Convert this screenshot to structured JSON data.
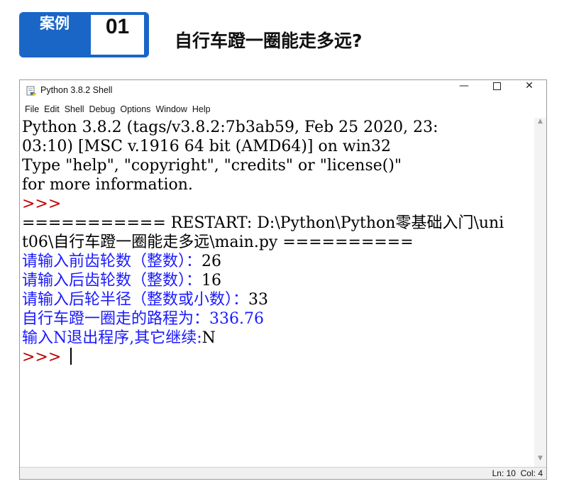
{
  "case": {
    "label": "案例",
    "number": "01",
    "title": "自行车蹬一圈能走多远?"
  },
  "window": {
    "title": "Python 3.8.2 Shell",
    "minimize_glyph": "—",
    "close_glyph": "✕",
    "icon": "idle-python-icon"
  },
  "menu": [
    "File",
    "Edit",
    "Shell",
    "Debug",
    "Options",
    "Window",
    "Help"
  ],
  "shell": {
    "lines": [
      {
        "text": "Python 3.8.2 (tags/v3.8.2:7b3ab59, Feb 25 2020, 23:",
        "type": "system"
      },
      {
        "text": "03:10) [MSC v.1916 64 bit (AMD64)] on win32",
        "type": "system"
      },
      {
        "text": "Type \"help\", \"copyright\", \"credits\" or \"license()\"",
        "type": "system"
      },
      {
        "text": "for more information.",
        "type": "system"
      },
      {
        "text": ">>>",
        "type": "prompt"
      },
      {
        "text": "=========== RESTART: D:\\Python\\Python零基础入门\\uni",
        "type": "system"
      },
      {
        "text": "t06\\自行车蹬一圈能走多远\\main.py ==========",
        "type": "system"
      },
      {
        "prompt": "请输入前齿轮数（整数）：",
        "value": "26",
        "type": "input"
      },
      {
        "prompt": "请输入后齿轮数（整数）：",
        "value": "16",
        "type": "input"
      },
      {
        "prompt": "请输入后轮半径（整数或小数）：",
        "value": "33",
        "type": "input"
      },
      {
        "text": "自行车蹬一圈走的路程为：336.76",
        "type": "output"
      },
      {
        "prompt": "输入N退出程序,其它继续:",
        "value": "N",
        "type": "input"
      }
    ],
    "current_prompt": ">>> "
  },
  "status": {
    "line": "Ln: 10",
    "col": "Col: 4"
  },
  "colors": {
    "accent": "#1a66c7",
    "output": "#1a1aff",
    "prompt": "#c00000",
    "text": "#000000"
  }
}
